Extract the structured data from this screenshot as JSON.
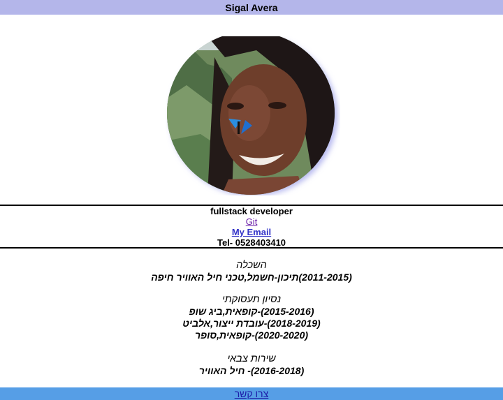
{
  "header": {
    "name": "Sigal Avera"
  },
  "profile": {
    "role": "fullstack developer",
    "git_link": "Git",
    "email_link": "My Email",
    "phone": "Tel- 0528403410"
  },
  "education": {
    "heading": "השכלה",
    "items": [
      "(2011-2015)תיכון-חשמל,טכני חיל האוויר חיפה"
    ]
  },
  "experience": {
    "heading": "נסיון תעסוקתי",
    "items": [
      "(2015-2016)-קופאית,ביג שופ",
      "(2018-2019)-עובדת ייצור,אלביט",
      "(2020-2020)-קופאית,סופר"
    ]
  },
  "military": {
    "heading": "שירות צבאי",
    "items": [
      "(2016-2018)- חיל האוויר"
    ]
  },
  "footer": {
    "contact_link": "צרו קשר"
  },
  "colors": {
    "topbar": "#b4b6ea",
    "footer": "#569ee6",
    "photo_glow": "#b7b9f0"
  }
}
